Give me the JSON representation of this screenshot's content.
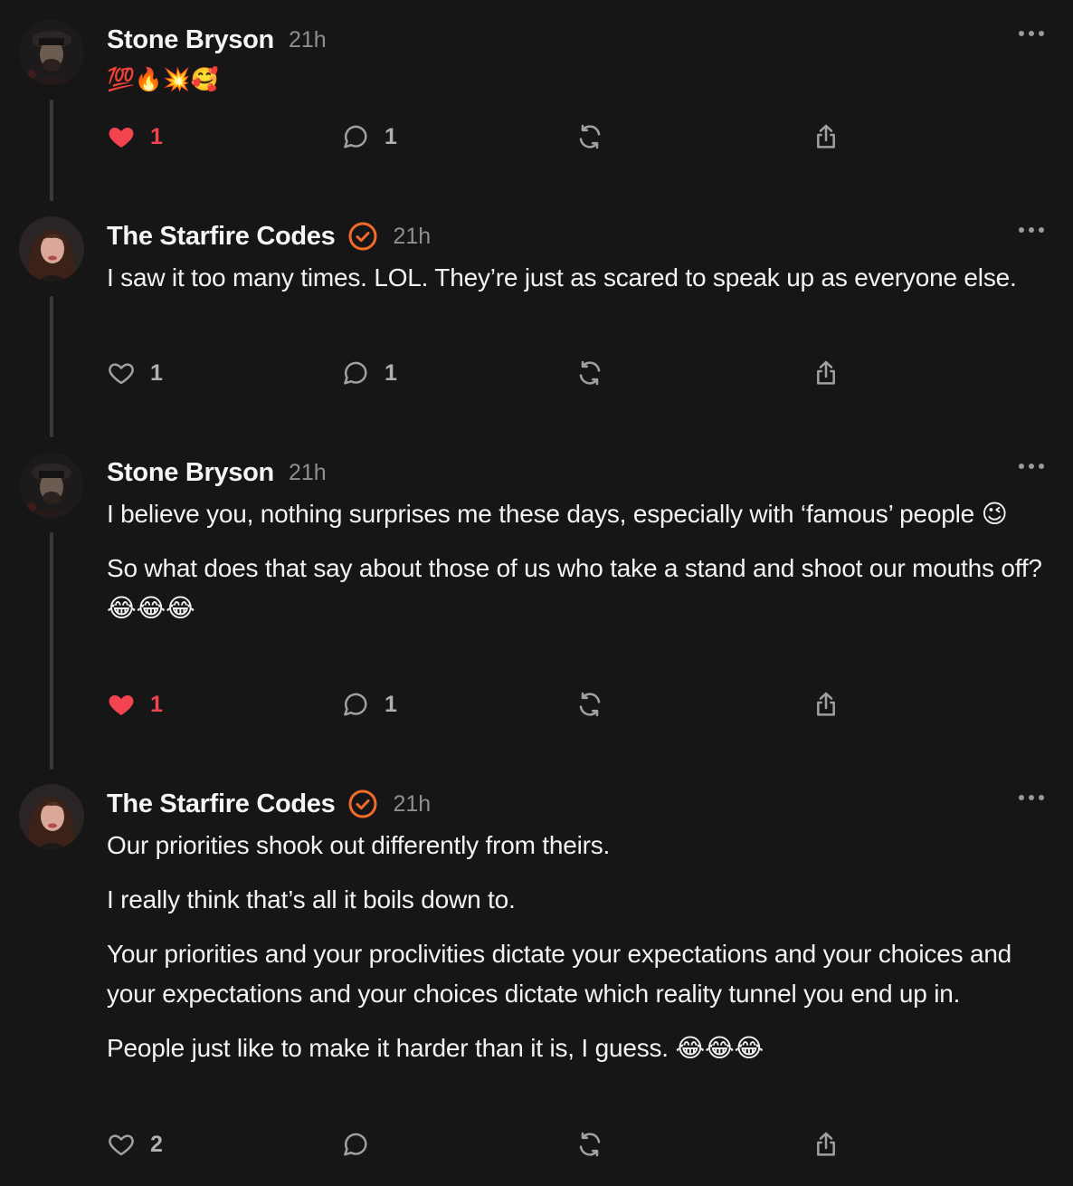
{
  "posts": [
    {
      "author": "Stone Bryson",
      "time": "21h",
      "verified": false,
      "paragraphs": [
        "💯🔥💥🥰"
      ],
      "likes": "1",
      "liked": true,
      "replies": "1"
    },
    {
      "author": "The Starfire Codes",
      "time": "21h",
      "verified": true,
      "paragraphs": [
        "I saw it too many times. LOL. They’re just as scared to speak up as everyone else."
      ],
      "likes": "1",
      "liked": false,
      "replies": "1"
    },
    {
      "author": "Stone Bryson",
      "time": "21h",
      "verified": false,
      "paragraphs": [
        "I believe you, nothing surprises me these days, especially with ‘famous’ people 😉",
        "So what does that say about those of us who take a stand and shoot our mouths off? 😂😂😂"
      ],
      "likes": "1",
      "liked": true,
      "replies": "1"
    },
    {
      "author": "The Starfire Codes",
      "time": "21h",
      "verified": true,
      "paragraphs": [
        "Our priorities shook out differently from theirs.",
        "I really think that’s all it boils down to.",
        "Your priorities and your proclivities dictate your expectations and your choices and your expectations and your choices dictate which reality tunnel you end up in.",
        "People just like to make it harder than it is, I guess. 😂😂😂"
      ],
      "likes": "2",
      "liked": false,
      "replies": ""
    }
  ],
  "colors": {
    "background": "#161617",
    "like_active": "#f2444e",
    "verified": "#f26b2a",
    "icon": "#a0a0a4"
  },
  "icons": {
    "like": "heart-icon",
    "reply": "speech-bubble-icon",
    "repost": "repost-arrows-icon",
    "share": "share-upload-icon",
    "more": "ellipsis-icon",
    "verified": "verified-check-icon"
  }
}
